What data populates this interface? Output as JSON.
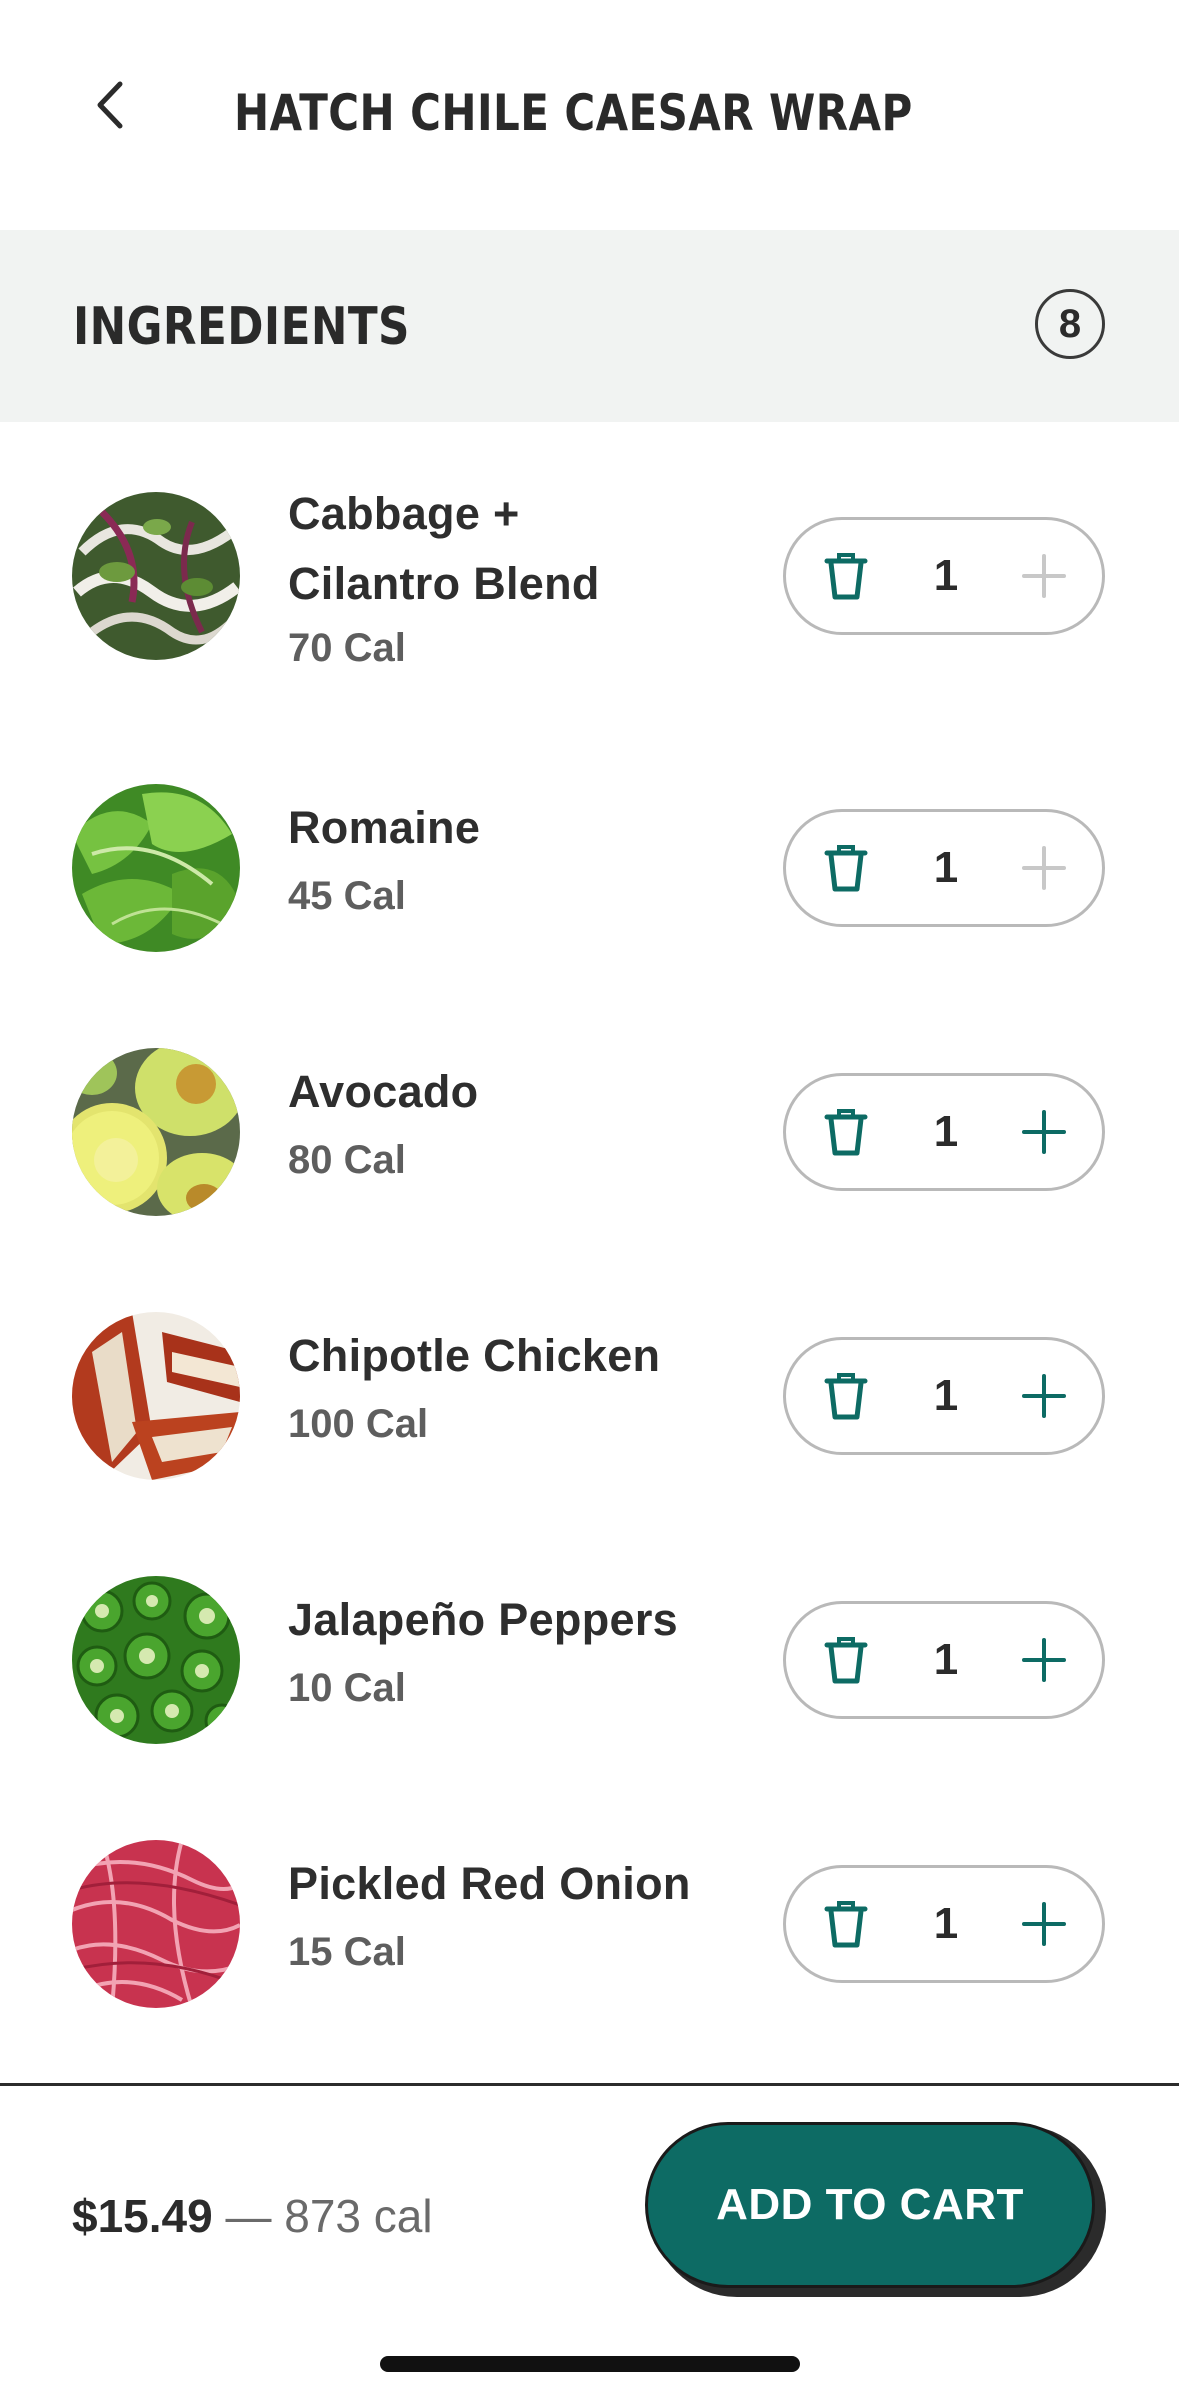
{
  "header": {
    "title": "HATCH CHILE CAESAR WRAP",
    "back_icon": "chevron-left-icon"
  },
  "section": {
    "title": "INGREDIENTS",
    "count": "8"
  },
  "ingredients": [
    {
      "name_line1": "Cabbage +",
      "name_line2": "Cilantro Blend",
      "cal": "70 Cal",
      "qty": "1",
      "plus_enabled": false,
      "image": "cabbage-cilantro"
    },
    {
      "name_line1": "Romaine",
      "cal": "45 Cal",
      "qty": "1",
      "plus_enabled": false,
      "image": "romaine"
    },
    {
      "name_line1": "Avocado",
      "cal": "80 Cal",
      "qty": "1",
      "plus_enabled": true,
      "image": "avocado"
    },
    {
      "name_line1": "Chipotle Chicken",
      "cal": "100 Cal",
      "qty": "1",
      "plus_enabled": true,
      "image": "chipotle-chicken"
    },
    {
      "name_line1": "Jalapeño Peppers",
      "cal": "10 Cal",
      "qty": "1",
      "plus_enabled": true,
      "image": "jalapeno"
    },
    {
      "name_line1": "Pickled Red Onion",
      "cal": "15 Cal",
      "qty": "1",
      "plus_enabled": true,
      "image": "pickled-onion"
    }
  ],
  "footer": {
    "price": "$15.49",
    "separator": "—",
    "calories": "873 cal",
    "add_to_cart": "ADD TO CART"
  },
  "colors": {
    "accent": "#0d6b64",
    "disabled": "#c8c8c8",
    "section_bg": "#f1f3f2",
    "text": "#2b2b2b"
  }
}
